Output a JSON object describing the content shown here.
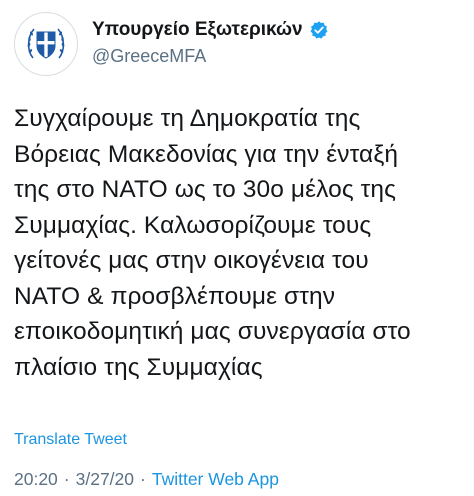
{
  "account": {
    "display_name": "Υπουργείο Εξωτερικών",
    "handle": "@GreeceMFA",
    "verified_icon": "verified-badge-icon",
    "avatar_icon": "greek-coat-of-arms-icon"
  },
  "tweet": {
    "text": "Συγχαίρουμε τη Δημοκρατία της\nΒόρειας Μακεδονίας για την ένταξή\nτης στο ΝΑΤΟ ως το 30ο μέλος της\nΣυμμαχίας. Καλωσορίζουμε τους\nγείτονές μας στην οικογένεια του\nΝΑΤΟ & προσβλέπουμε στην\nεποικοδομητική μας συνεργασία στο\nπλαίσιο της Συμμαχίας",
    "translate_label": "Translate Tweet",
    "time": "20:20",
    "date": "3/27/20",
    "separator": "·",
    "source": "Twitter Web App"
  },
  "colors": {
    "link": "#1b95e0",
    "secondary_text": "#5b7083",
    "primary_text": "#14171a",
    "verified": "#1da1f2",
    "emblem_blue": "#1f5aa6"
  }
}
